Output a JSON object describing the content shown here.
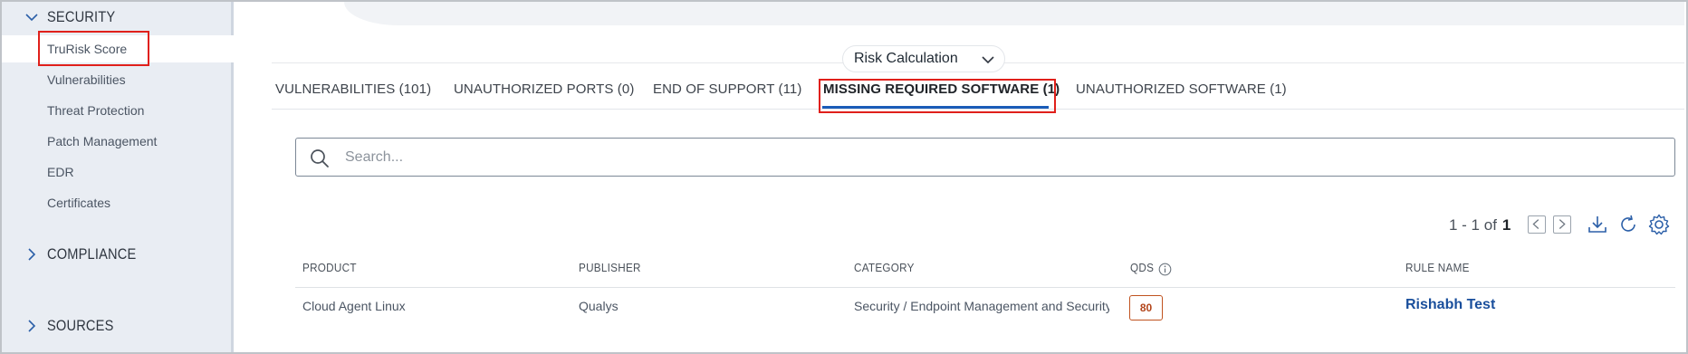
{
  "sidebar": {
    "sections": {
      "security": {
        "label": "SECURITY",
        "expanded": true
      },
      "compliance": {
        "label": "COMPLIANCE",
        "expanded": false
      },
      "sources": {
        "label": "SOURCES",
        "expanded": false
      }
    },
    "items": [
      {
        "label": "TruRisk Score",
        "active": true
      },
      {
        "label": "Vulnerabilities"
      },
      {
        "label": "Threat Protection"
      },
      {
        "label": "Patch Management"
      },
      {
        "label": "EDR"
      },
      {
        "label": "Certificates"
      }
    ]
  },
  "risk_calculation": {
    "label": "Risk Calculation",
    "icon": "chevron-down-icon"
  },
  "tabs": [
    {
      "label": "VULNERABILITIES (101)"
    },
    {
      "label": "UNAUTHORIZED PORTS (0)"
    },
    {
      "label": "END OF SUPPORT (11)"
    },
    {
      "label": "MISSING REQUIRED SOFTWARE (1)",
      "active": true
    },
    {
      "label": "UNAUTHORIZED SOFTWARE (1)"
    }
  ],
  "search": {
    "placeholder": "Search...",
    "value": ""
  },
  "pager": {
    "range": "1 - 1 of",
    "total": "1"
  },
  "table": {
    "columns": [
      "PRODUCT",
      "PUBLISHER",
      "CATEGORY",
      "QDS",
      "RULE NAME"
    ],
    "rows": [
      {
        "product": "Cloud Agent Linux",
        "publisher": "Qualys",
        "category": "Security / Endpoint Management and Security",
        "qds": "80",
        "rule_name": "Rishabh Test"
      }
    ]
  },
  "colors": {
    "accent": "#1a5cb8",
    "highlight_box": "#e0201b",
    "qds_badge": "#b3451a",
    "link": "#1a4f9c"
  }
}
